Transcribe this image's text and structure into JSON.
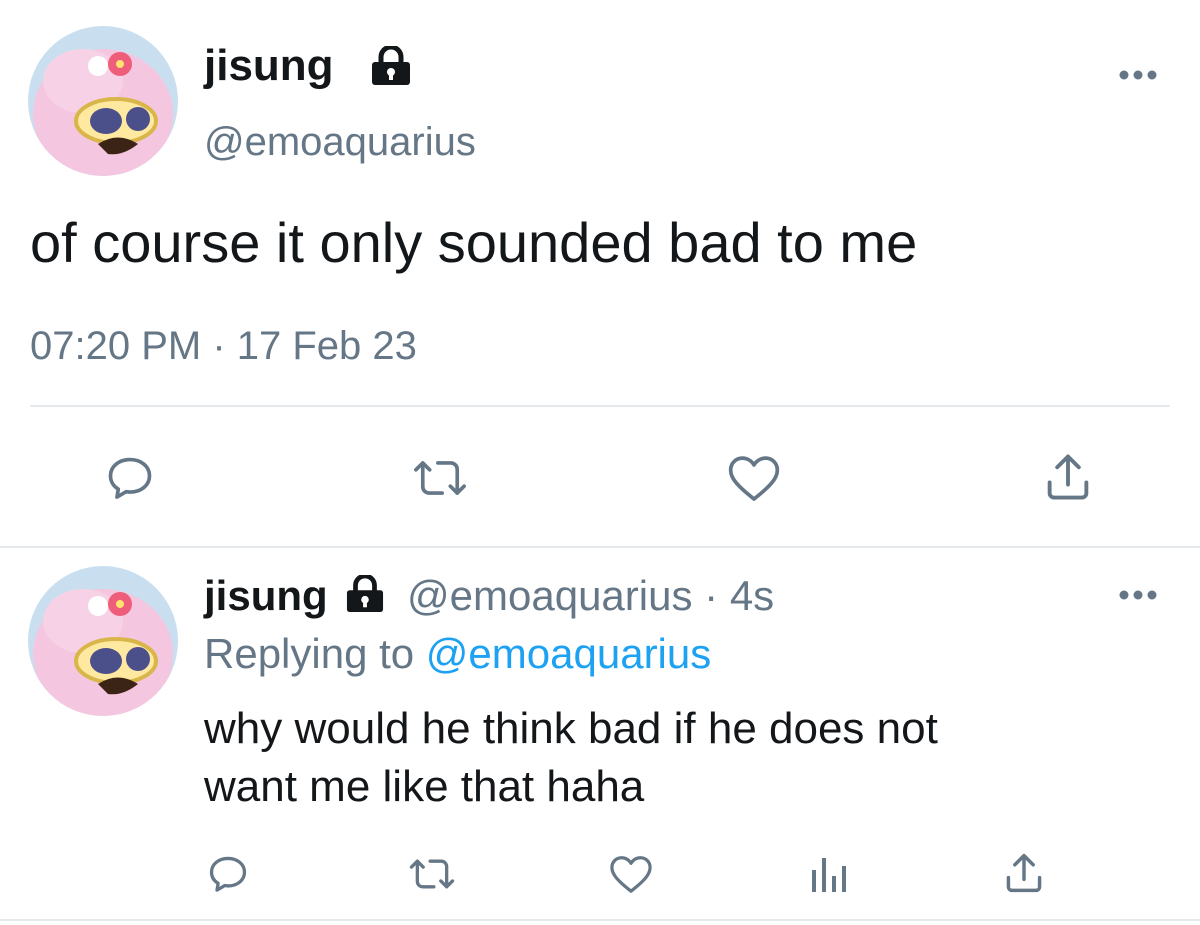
{
  "main_tweet": {
    "display_name": "jisung",
    "handle": "@emoaquarius",
    "text": "of course it only sounded bad to me",
    "timestamp": "07:20 PM · 17 Feb 23",
    "actions": [
      "reply-icon",
      "retweet-icon",
      "like-icon",
      "share-icon"
    ]
  },
  "reply_tweet": {
    "display_name": "jisung",
    "handle": "@emoaquarius",
    "dot": "·",
    "age": "4s",
    "replying_prefix": "Replying to",
    "replying_handle": "@emoaquarius",
    "text_line1": "why would he think bad if he does not",
    "text_line2": "want me like that haha",
    "actions": [
      "reply-icon",
      "retweet-icon",
      "like-icon",
      "analytics-icon",
      "share-icon"
    ]
  },
  "colors": {
    "text": "#14171a",
    "muted": "#657786",
    "link": "#1da1f2",
    "icon": "#657786",
    "divider": "#e6e9ec"
  }
}
